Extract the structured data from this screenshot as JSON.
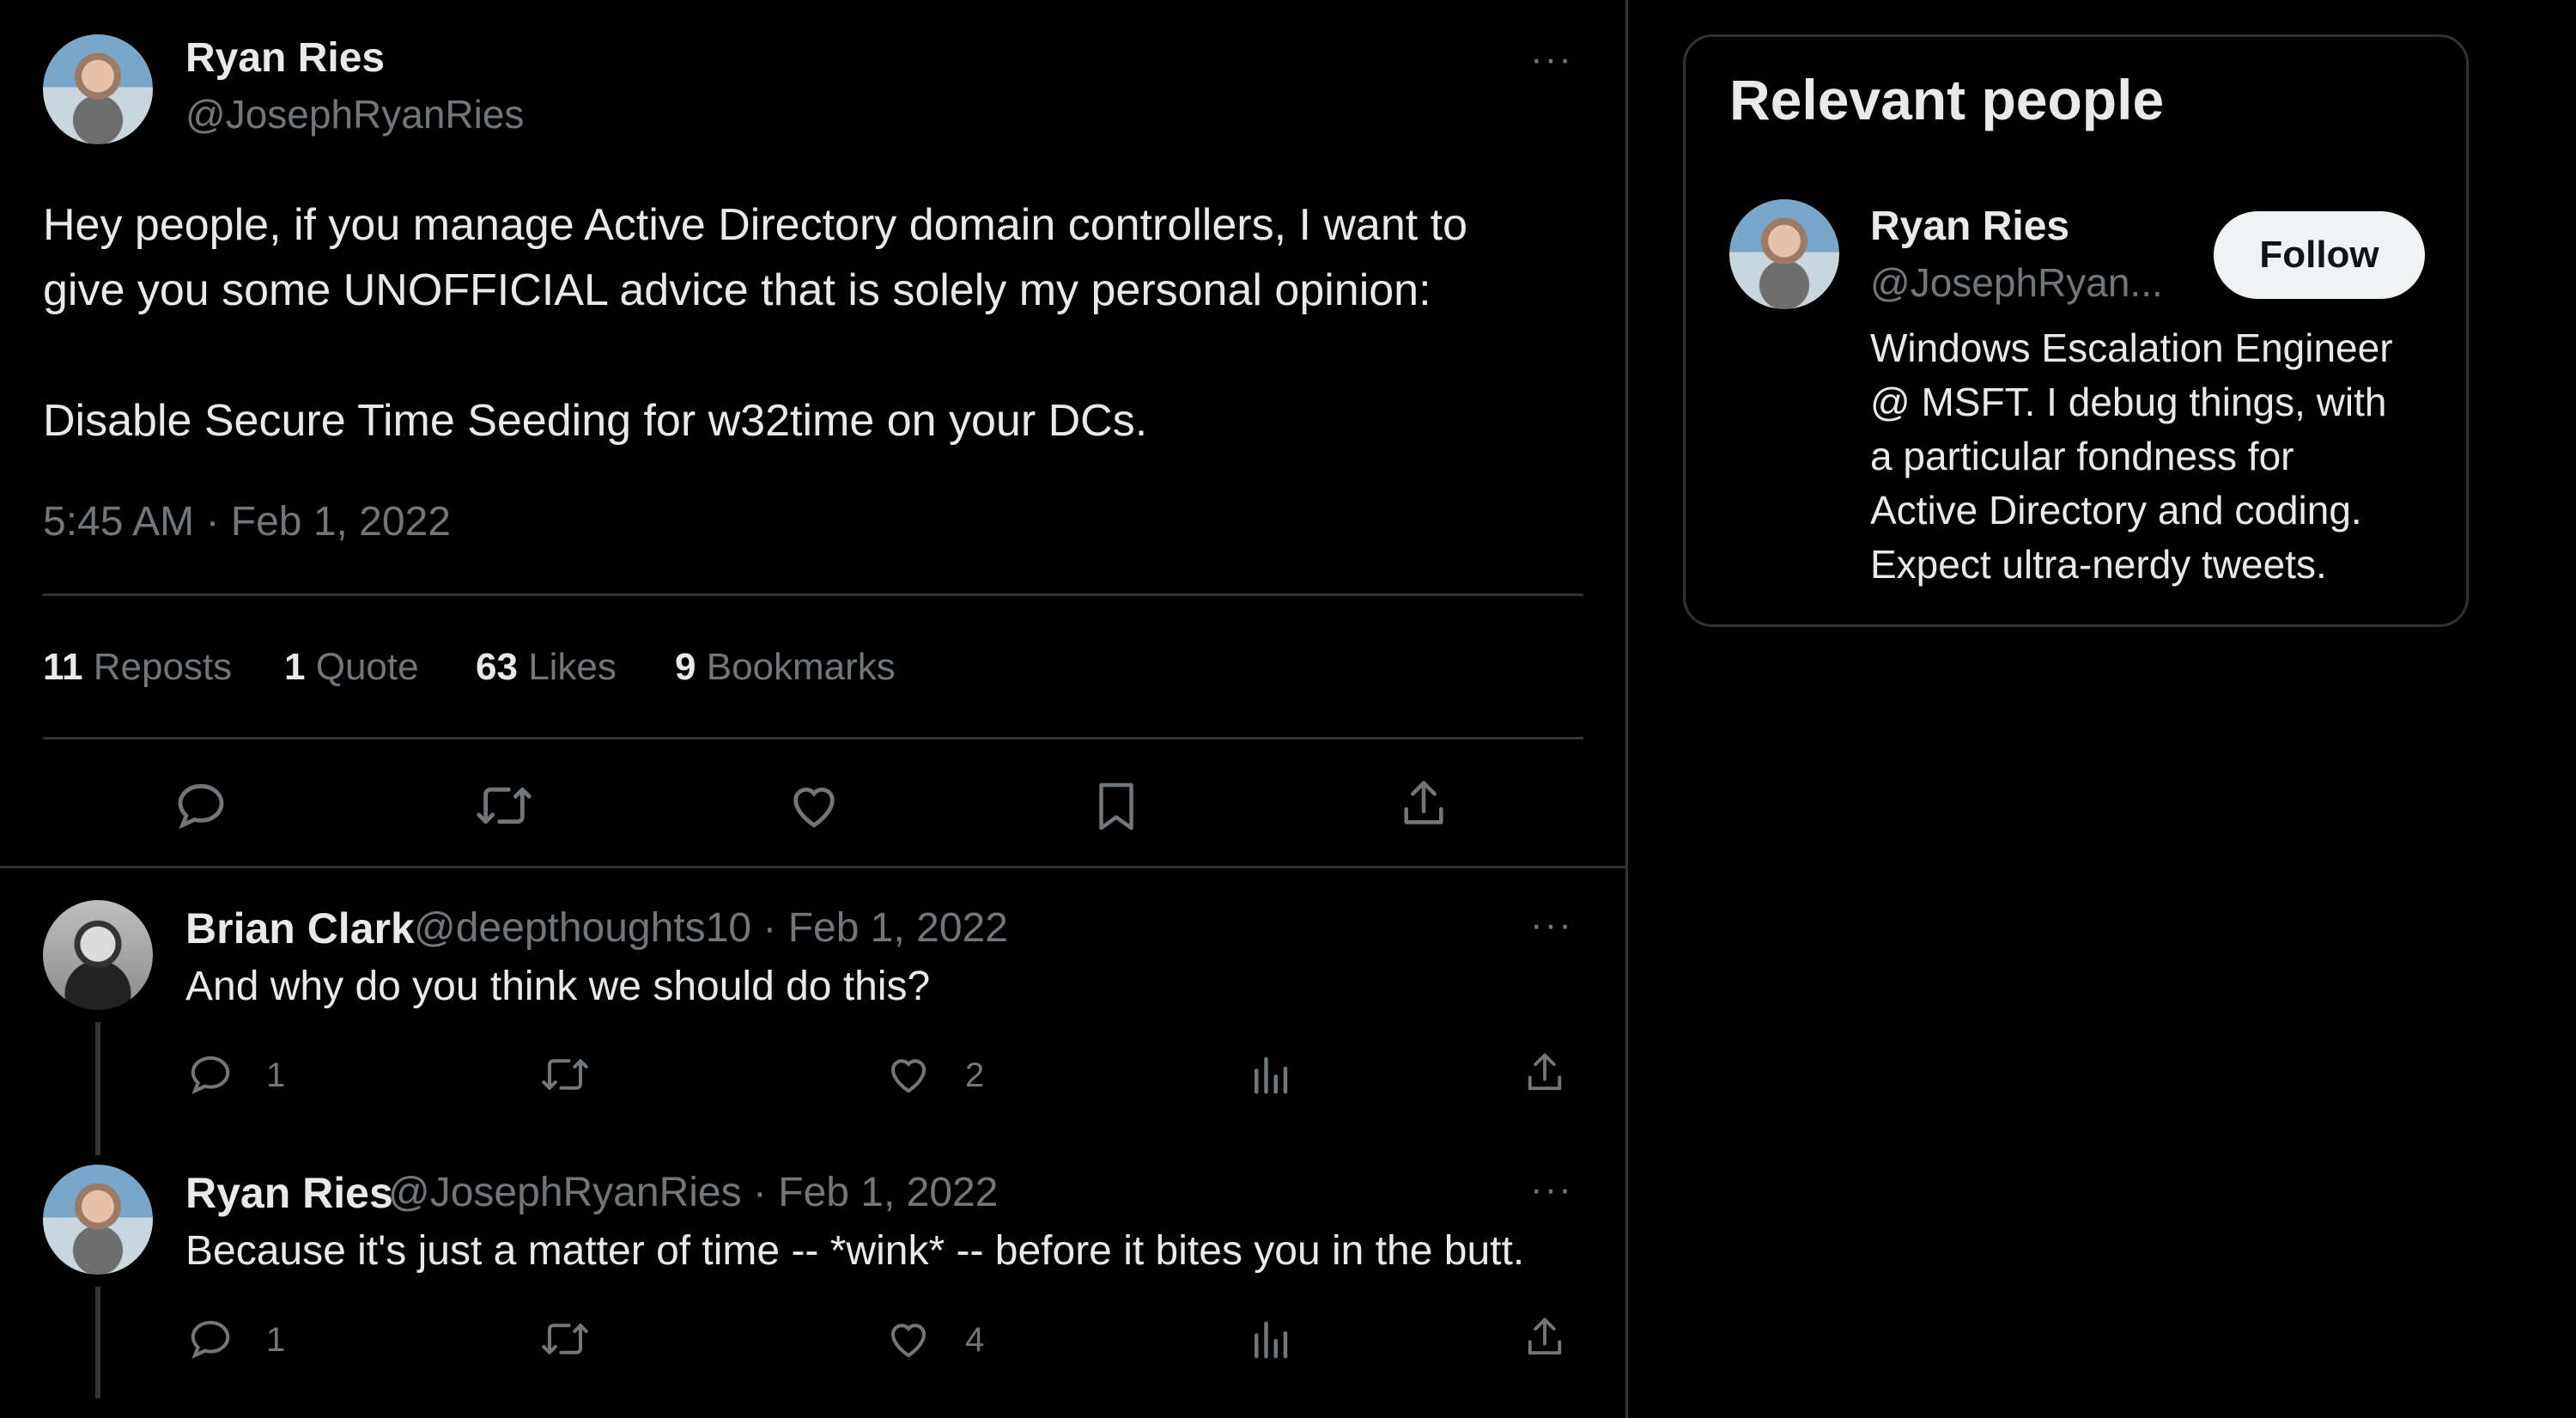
{
  "main_tweet": {
    "author_name": "Ryan Ries",
    "author_handle": "@JosephRyanRies",
    "more": "···",
    "text_line1": "Hey people, if you manage Active Directory domain controllers, I want to",
    "text_line2": "give you some UNOFFICIAL advice that is solely my personal opinion:",
    "text_line3": "Disable Secure Time Seeding for w32time on your DCs.",
    "timestamp": "5:45 AM · Feb 1, 2022",
    "stats": {
      "reposts_count": "11",
      "reposts_label": "Reposts",
      "quote_count": "1",
      "quote_label": "Quote",
      "likes_count": "63",
      "likes_label": "Likes",
      "bookmarks_count": "9",
      "bookmarks_label": "Bookmarks"
    },
    "actions": [
      "reply-icon",
      "repost-icon",
      "like-icon",
      "bookmark-icon",
      "share-icon"
    ]
  },
  "replies": [
    {
      "author_name": "Brian Clark",
      "author_handle": "@deepthoughts10 · Feb 1, 2022",
      "more": "···",
      "text": "And why do you think we should do this?",
      "reply_count": "1",
      "like_count": "2"
    },
    {
      "author_name": "Ryan Ries",
      "author_handle": "@JosephRyanRies · Feb 1, 2022",
      "more": "···",
      "text": "Because it's just a matter of time -- *wink* -- before it bites you in the butt.",
      "reply_count": "1",
      "like_count": "4"
    }
  ],
  "sidebar": {
    "title": "Relevant people",
    "person": {
      "name": "Ryan Ries",
      "handle": "@JosephRyan...",
      "follow_label": "Follow",
      "bio_line1": "Windows Escalation Engineer",
      "bio_line2": "@ MSFT. I debug things, with",
      "bio_line3": "a particular fondness for",
      "bio_line4": "Active Directory and coding.",
      "bio_line5": "Expect ultra-nerdy tweets."
    }
  },
  "colors": {
    "background": "#000000",
    "text": "#e7e9ea",
    "secondary": "#71767b",
    "border": "#2f3336",
    "follow_bg": "#eff3f4"
  }
}
